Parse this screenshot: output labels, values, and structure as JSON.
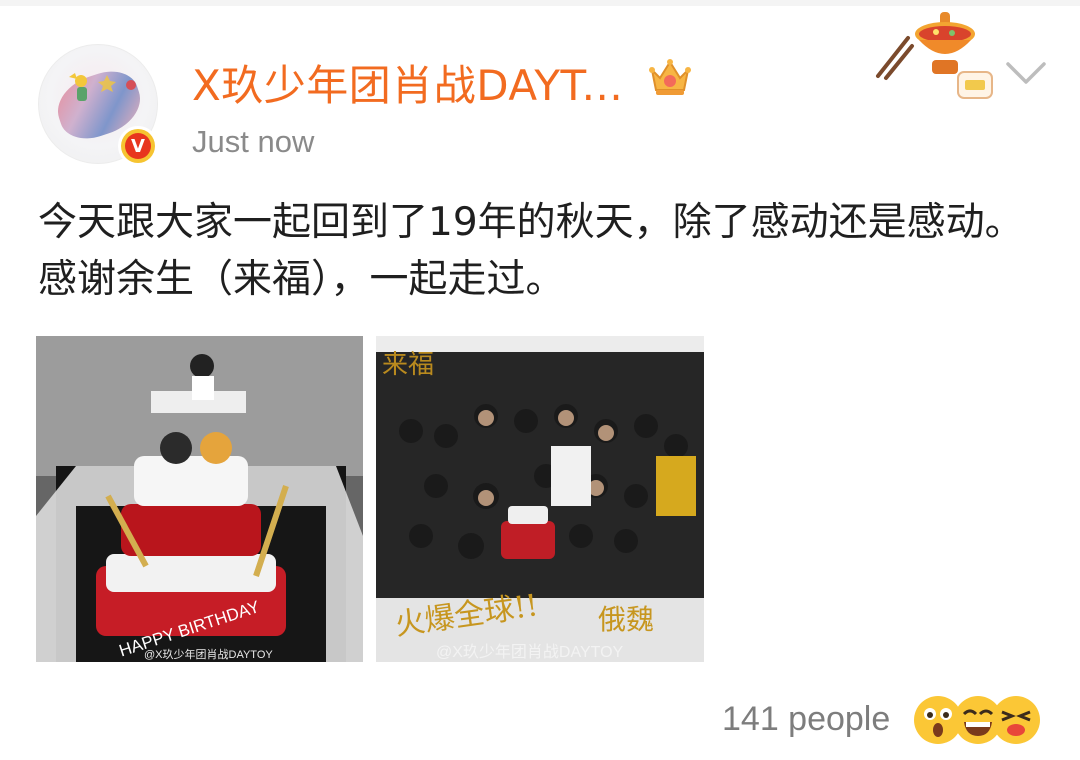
{
  "post": {
    "username": "X玖少年团肖战DAYT...",
    "timestamp": "Just now",
    "text": "今天跟大家一起回到了19年的秋天，除了感动还是感动。感谢余生（来福），一起走过。",
    "verified_badge": "V"
  },
  "photos": [
    {
      "watermark": "@X玖少年团肖战DAYTOY",
      "cake_text": "HAPPY BIRTHDAY"
    },
    {
      "watermark": "@X玖少年团肖战DAYTOY",
      "handwriting": [
        "来福",
        "火爆全球!!",
        "俄魏"
      ]
    }
  ],
  "reactions": {
    "count_text": "141 people",
    "icons": [
      "surprised-face-icon",
      "laughing-face-icon",
      "squinting-face-icon"
    ]
  },
  "icons": {
    "chevron": "chevron-down-icon",
    "crown": "crown-icon",
    "decoration": "hotpot-decoration"
  },
  "colors": {
    "username": "#f26b20",
    "timestamp": "#8a8a8a",
    "text": "#1f1f1f",
    "verified": "#e8351e"
  }
}
